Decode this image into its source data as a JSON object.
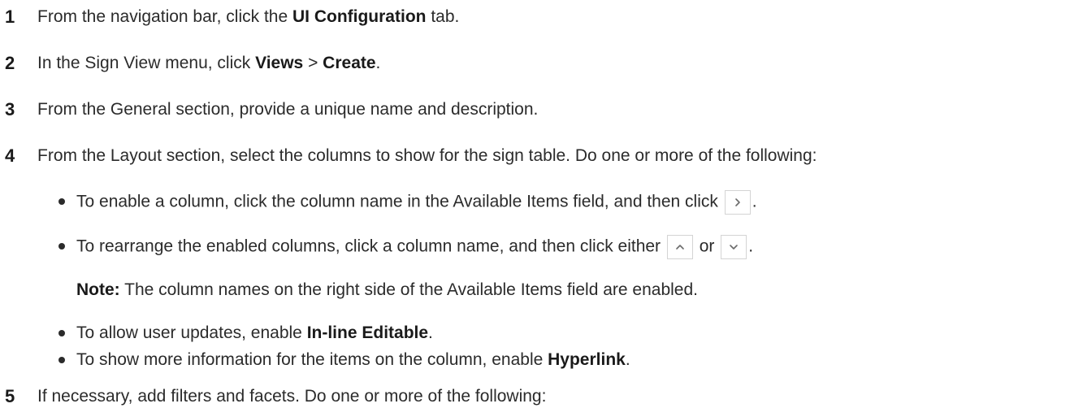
{
  "steps": [
    {
      "num": "1",
      "pre": "From the navigation bar, click the ",
      "bold": "UI Configuration",
      "post": " tab."
    },
    {
      "num": "2",
      "pre": "In the Sign View menu, click ",
      "bold1": "Views",
      "mid": " > ",
      "bold2": "Create",
      "post": "."
    },
    {
      "num": "3",
      "text": "From the General section, provide a unique name and description."
    },
    {
      "num": "4",
      "text": "From the Layout section, select the columns to show for the sign table. Do one or more of the following:"
    },
    {
      "num": "5",
      "text": "If necessary, add filters and facets. Do one or more of the following:"
    }
  ],
  "bullets": {
    "enable": {
      "pre": "To enable a column, click the column name in the Available Items field, and then click",
      "post": "."
    },
    "rearrange": {
      "pre": "To rearrange the enabled columns, click a column name, and then click either",
      "mid": "or",
      "post": "."
    },
    "note": {
      "label": "Note:",
      "text": " The column names on the right side of the Available Items field are enabled."
    },
    "inline": {
      "pre": "To allow user updates, enable ",
      "bold": "In-line Editable",
      "post": "."
    },
    "hyperlink": {
      "pre": "To show more information for the items on the column, enable ",
      "bold": "Hyperlink",
      "post": "."
    }
  },
  "icons": {
    "move_right": "chevron-right-icon",
    "move_up": "chevron-up-icon",
    "move_down": "chevron-down-icon"
  }
}
